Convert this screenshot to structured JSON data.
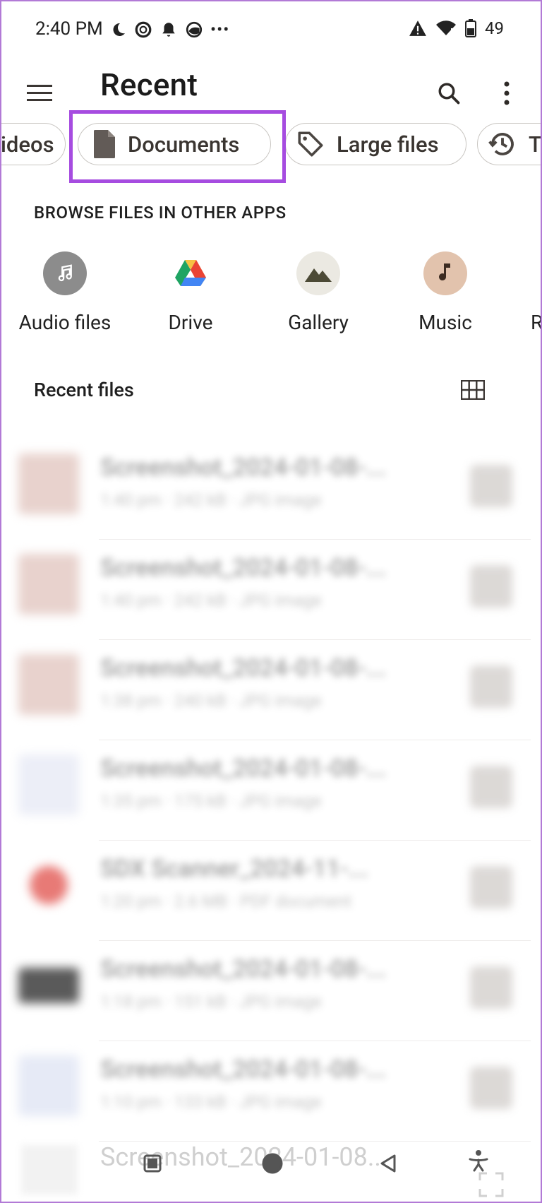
{
  "status_bar": {
    "time": "2:40 PM",
    "battery": "49",
    "icons": [
      "moon-icon",
      "ring-icon",
      "bell-icon",
      "sync-icon",
      "more-dots-icon",
      "alert-icon",
      "wifi-icon",
      "battery-icon"
    ]
  },
  "app_bar": {
    "title": "Recent",
    "icons": [
      "menu-icon",
      "search-icon",
      "more-vert-icon"
    ]
  },
  "chips": [
    {
      "label": "ideos",
      "icon": "videos"
    },
    {
      "label": "Documents",
      "icon": "document-icon"
    },
    {
      "label": "Large files",
      "icon": "tag-icon"
    },
    {
      "label": "T",
      "icon": "history-icon"
    }
  ],
  "browse": {
    "heading": "BROWSE FILES IN OTHER APPS",
    "apps": [
      {
        "label": "Audio files",
        "icon": "music-note-icon",
        "color": "#8c8c8c"
      },
      {
        "label": "Drive",
        "icon": "drive-icon"
      },
      {
        "label": "Gallery",
        "icon": "mountain-icon",
        "color": "#ebe9e2"
      },
      {
        "label": "Music",
        "icon": "music-note-icon",
        "color": "#e2c3ad"
      },
      {
        "label": "R",
        "icon": ""
      }
    ]
  },
  "recent": {
    "heading": "Recent files",
    "view_icon": "grid-view-icon",
    "files": [
      {
        "name": "Screenshot_2024-01-08-...",
        "meta": "1:40 pm · 242 kB · JPG image",
        "thumb_color": "#e8d2cd"
      },
      {
        "name": "Screenshot_2024-01-08-...",
        "meta": "1:40 pm · 242 kB · JPG image",
        "thumb_color": "#e8d2cd"
      },
      {
        "name": "Screenshot_2024-01-08-...",
        "meta": "1:38 pm · 240 kB · JPG image",
        "thumb_color": "#e8d2cd"
      },
      {
        "name": "Screenshot_2024-01-08-...",
        "meta": "1:35 pm · 175 kB · JPG image",
        "thumb_color": "#eceef7"
      },
      {
        "name": "SDX Scanner_2024-11-...",
        "meta": "1:20 pm · 2.6 MB · PDF document",
        "thumb_color": "#e87a76"
      },
      {
        "name": "Screenshot_2024-01-08-...",
        "meta": "1:18 pm · 151 kB · JPG image",
        "thumb_color": "#5a5a5a"
      },
      {
        "name": "Screenshot_2024-01-08-...",
        "meta": "1:10 pm · 133 kB · JPG image",
        "thumb_color": "#e6eaf6"
      }
    ]
  },
  "bottom": {
    "ghost_text": "Screenshot_2024-01-08..."
  }
}
